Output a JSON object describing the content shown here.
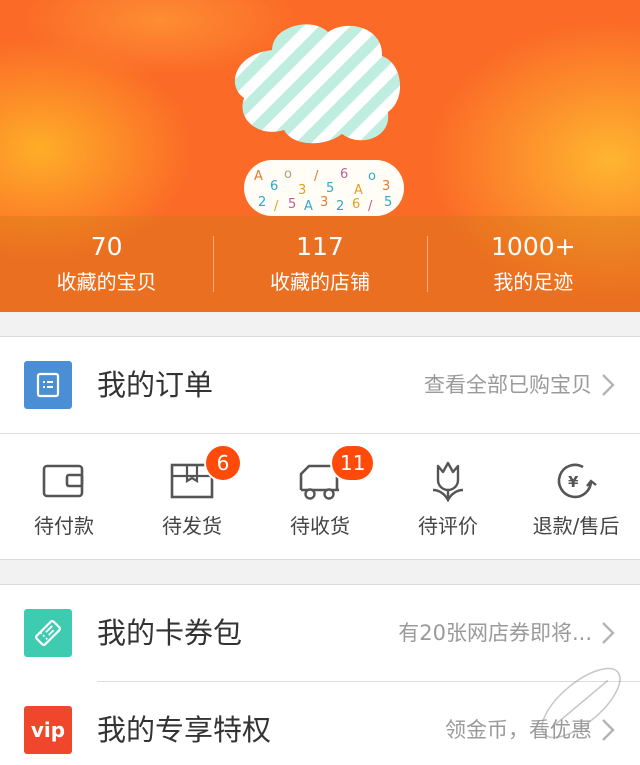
{
  "profile": {
    "stats": [
      {
        "value": "70",
        "label": "收藏的宝贝"
      },
      {
        "value": "117",
        "label": "收藏的店铺"
      },
      {
        "value": "1000+",
        "label": "我的足迹"
      }
    ]
  },
  "orders": {
    "title": "我的订单",
    "view_all": "查看全部已购宝贝",
    "statuses": [
      {
        "label": "待付款",
        "icon": "wallet-icon"
      },
      {
        "label": "待发货",
        "icon": "package-icon",
        "badge": "6"
      },
      {
        "label": "待收货",
        "icon": "truck-icon",
        "badge": "11"
      },
      {
        "label": "待评价",
        "icon": "tulip-icon"
      },
      {
        "label": "退款/售后",
        "icon": "refund-icon"
      }
    ]
  },
  "coupons": {
    "title": "我的卡券包",
    "detail": "有20张网店券即将..."
  },
  "vip": {
    "badge_text": "vip",
    "title": "我的专享特权",
    "detail": "领金币，看优惠"
  },
  "colors": {
    "header_orange": "#fb6a27",
    "orders_icon_blue": "#4a8fd6",
    "coupon_icon_teal": "#3ecbb0",
    "vip_icon_red": "#f0462c",
    "badge_red": "#ff4a0a"
  }
}
